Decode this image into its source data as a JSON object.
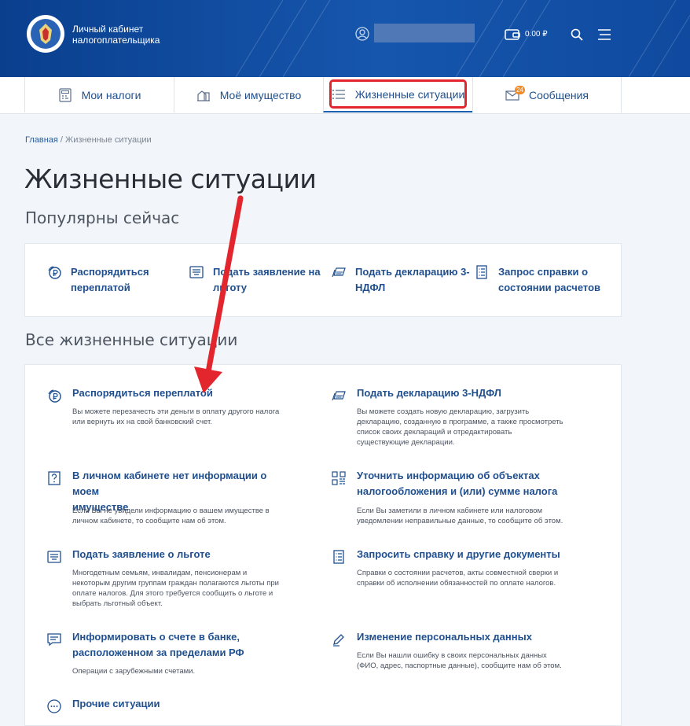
{
  "header": {
    "brand_line1": "Личный кабинет",
    "brand_line2": "налогоплательщика",
    "balance": "0.00 ₽"
  },
  "tabs": [
    {
      "label": "Мои налоги",
      "icon": "calculator-icon"
    },
    {
      "label": "Моё имущество",
      "icon": "property-icon"
    },
    {
      "label": "Жизненные ситуации",
      "icon": "list-icon"
    },
    {
      "label": "Сообщения",
      "icon": "envelope-icon",
      "badge": "24"
    }
  ],
  "breadcrumb": {
    "home": "Главная",
    "separator": " / ",
    "current": "Жизненные ситуации"
  },
  "page_title": "Жизненные ситуации",
  "popular": {
    "title": "Популярны сейчас",
    "items": [
      {
        "line1": "Распорядиться",
        "line2": "переплатой"
      },
      {
        "line1": "Подать заявление на",
        "line2": "льготу"
      },
      {
        "line1": "Подать декларацию 3-",
        "line2": "НДФЛ"
      },
      {
        "line1": "Запрос справки о",
        "line2": "состоянии расчетов"
      }
    ]
  },
  "all": {
    "title": "Все жизненные ситуации",
    "items": [
      {
        "title": "Распорядиться переплатой",
        "desc": [
          "Вы можете перезачесть эти деньги в оплату другого налога",
          "или вернуть их на свой банковский счет."
        ]
      },
      {
        "title": "Подать декларацию 3-НДФЛ",
        "desc": [
          "Вы можете создать новую декларацию, загрузить",
          "декларацию, созданную в программе, а также просмотреть",
          "список своих деклараций и отредактировать",
          "существующие декларации."
        ]
      },
      {
        "title": "В личном кабинете нет информации о моем",
        "title2": "имуществе",
        "desc": [
          "Если Вы не увидели информацию о вашем имуществе в",
          "личном кабинете, то сообщите нам об этом."
        ]
      },
      {
        "title": "Уточнить информацию об объектах",
        "title2": "налогообложения и (или) сумме налога",
        "desc": [
          "Если Вы заметили в личном кабинете или налоговом",
          "уведомлении неправильные данные, то сообщите об этом."
        ]
      },
      {
        "title": "Подать заявление о льготе",
        "desc": [
          "Многодетным семьям, инвалидам, пенсионерам и",
          "некоторым другим группам граждан полагаются льготы при",
          "оплате налогов. Для этого требуется сообщить о льготе и",
          "выбрать льготный объект."
        ]
      },
      {
        "title": "Запросить справку и другие документы",
        "desc": [
          "Справки о состоянии расчетов, акты совместной сверки и",
          "справки об исполнении обязанностей по оплате налогов."
        ]
      },
      {
        "title": "Информировать о счете в банке,",
        "title2": "расположенном за пределами РФ",
        "desc": [
          "Операции с зарубежными счетами."
        ]
      },
      {
        "title": "Изменение персональных данных",
        "desc": [
          "Если Вы нашли ошибку в своих персональных данных",
          "(ФИО, адрес, паспортные данные), сообщите нам об этом."
        ]
      },
      {
        "title": "Прочие ситуации",
        "desc": []
      }
    ]
  },
  "colors": {
    "header_bg": "#1656ad",
    "link": "#1f4f8f",
    "highlight": "#e3262e",
    "badge": "#f28b25"
  }
}
